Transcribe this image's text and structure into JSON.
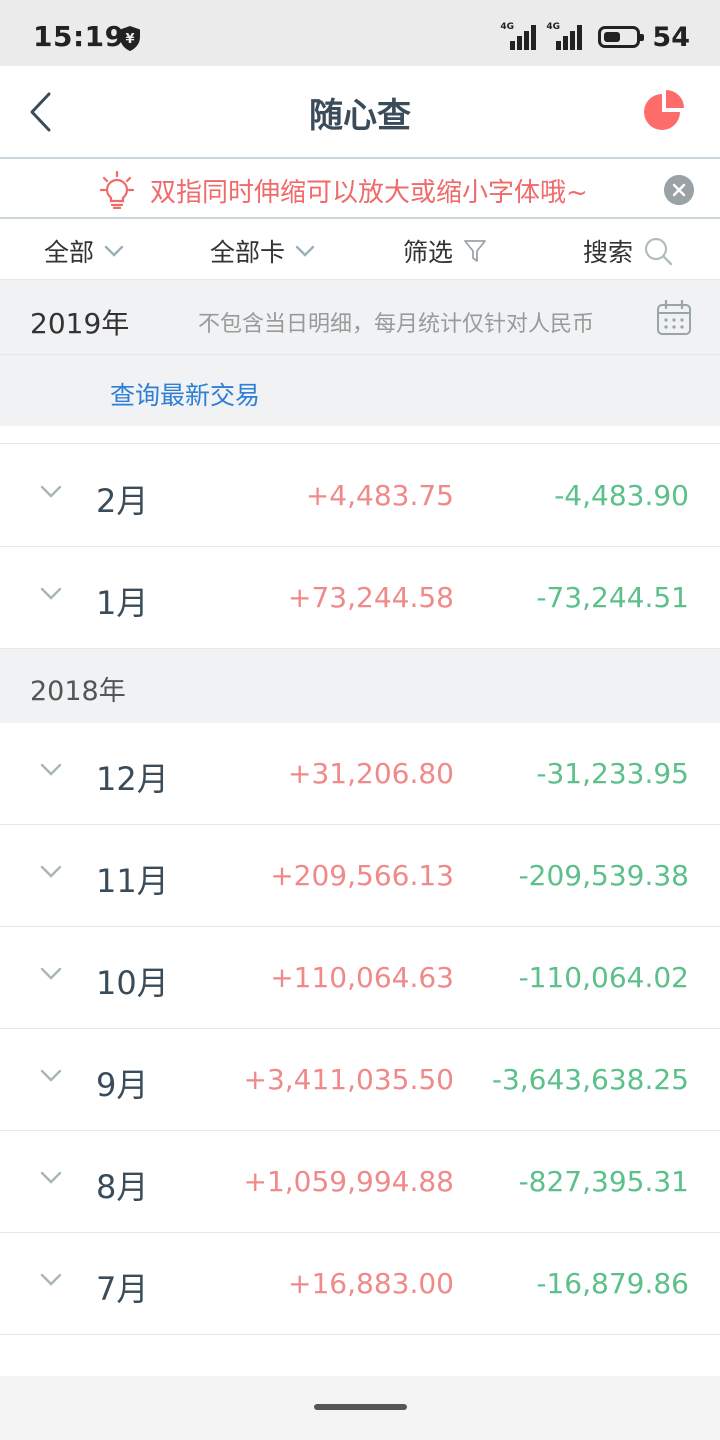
{
  "status_bar": {
    "time": "15:19",
    "currency_icon": "¥",
    "network_1": "4G",
    "network_2": "4G",
    "battery_percent": "54",
    "battery_level": 0.54
  },
  "header": {
    "title": "随心查",
    "back_icon": "chevron-left-icon",
    "chart_icon": "pie-chart-icon",
    "accent_color": "#fd6b6b"
  },
  "tip": {
    "text": "双指同时伸缩可以放大或缩小字体哦~",
    "icon": "lightbulb-icon",
    "color": "#f06a6a"
  },
  "filters": {
    "all_label": "全部",
    "all_card_label": "全部卡",
    "filter_label": "筛选",
    "search_label": "搜索"
  },
  "year_2019": {
    "title": "2019年",
    "note": "不包含当日明细，每月统计仅针对人民币",
    "query_link": "查询最新交易"
  },
  "year_2018": {
    "title": "2018年"
  },
  "colors": {
    "income": "#f08a8a",
    "expense": "#5cc08a",
    "link": "#2f7fd6"
  },
  "months_2019": [
    {
      "month": "2月",
      "income": "+4,483.75",
      "expense": "-4,483.90"
    },
    {
      "month": "1月",
      "income": "+73,244.58",
      "expense": "-73,244.51"
    }
  ],
  "months_2018": [
    {
      "month": "12月",
      "income": "+31,206.80",
      "expense": "-31,233.95"
    },
    {
      "month": "11月",
      "income": "+209,566.13",
      "expense": "-209,539.38"
    },
    {
      "month": "10月",
      "income": "+110,064.63",
      "expense": "-110,064.02"
    },
    {
      "month": "9月",
      "income": "+3,411,035.50",
      "expense": "-3,643,638.25"
    },
    {
      "month": "8月",
      "income": "+1,059,994.88",
      "expense": "-827,395.31"
    },
    {
      "month": "7月",
      "income": "+16,883.00",
      "expense": "-16,879.86"
    }
  ]
}
